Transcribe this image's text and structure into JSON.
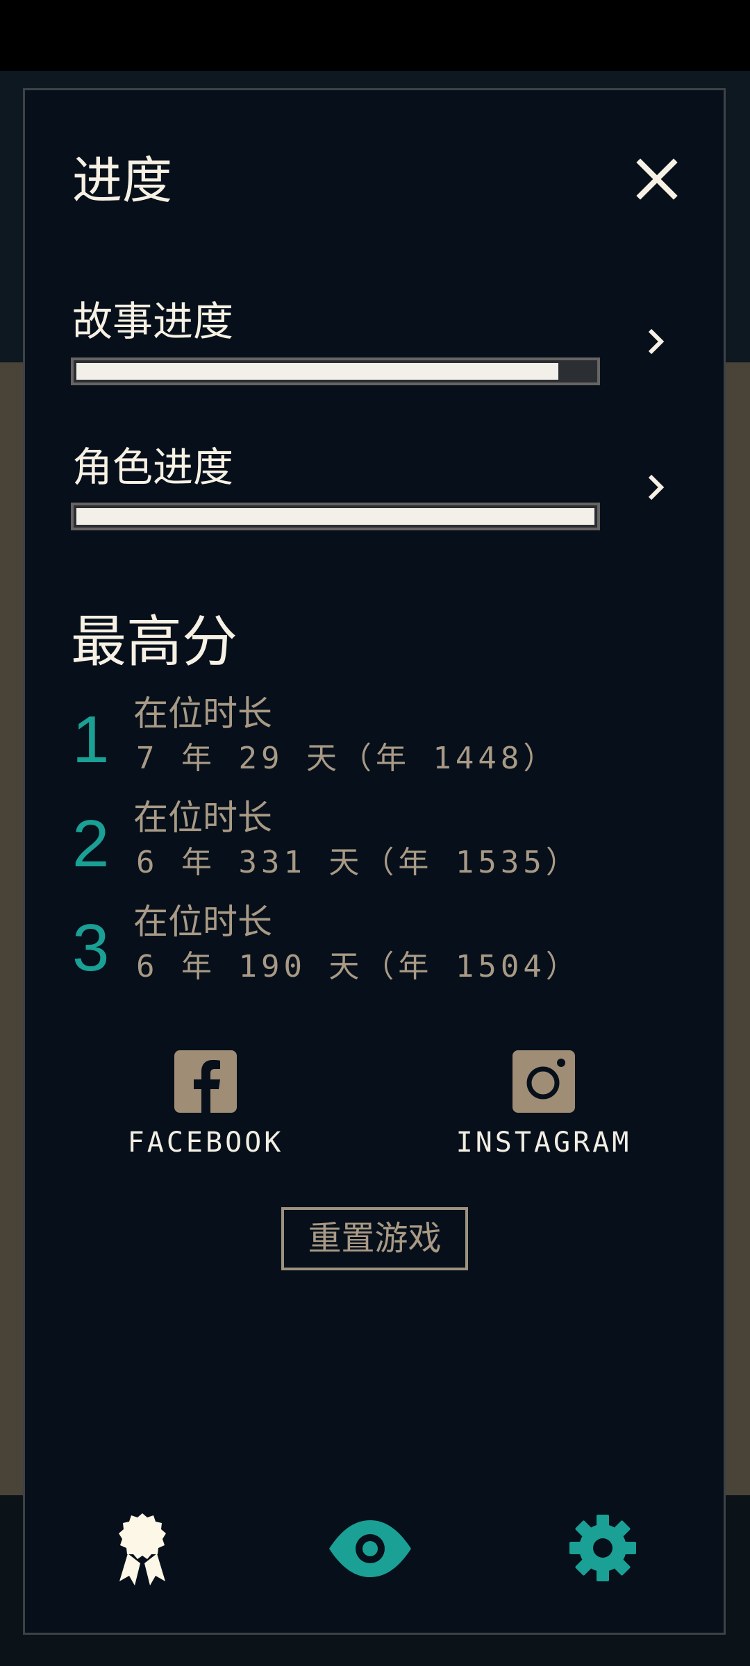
{
  "dialog": {
    "title": "进度",
    "close_icon": "close-icon"
  },
  "progress": [
    {
      "label": "故事进度",
      "fraction": 0.93,
      "chevron_icon": "chevron-right-icon"
    },
    {
      "label": "角色进度",
      "fraction": 1.0,
      "chevron_icon": "chevron-right-icon"
    }
  ],
  "high_scores": {
    "title": "最高分",
    "entries": [
      {
        "rank": "1",
        "label": "在位时长",
        "value": "7 年 29 天（年 1448）"
      },
      {
        "rank": "2",
        "label": "在位时长",
        "value": "6 年 331 天（年 1535）"
      },
      {
        "rank": "3",
        "label": "在位时长",
        "value": "6 年 190 天（年 1504）"
      }
    ]
  },
  "social": {
    "facebook": {
      "label": "FACEBOOK",
      "icon": "facebook-icon"
    },
    "instagram": {
      "label": "INSTAGRAM",
      "icon": "instagram-icon"
    }
  },
  "reset_button": "重置游戏",
  "bottom_nav": [
    {
      "icon": "award-ribbon-icon",
      "active": true
    },
    {
      "icon": "eye-icon",
      "active": false
    },
    {
      "icon": "gear-icon",
      "active": false
    }
  ],
  "colors": {
    "accent_teal": "#1aa095",
    "text_light": "#f6f1e4",
    "text_muted": "#a89a86",
    "panel_bg": "#07101a"
  }
}
